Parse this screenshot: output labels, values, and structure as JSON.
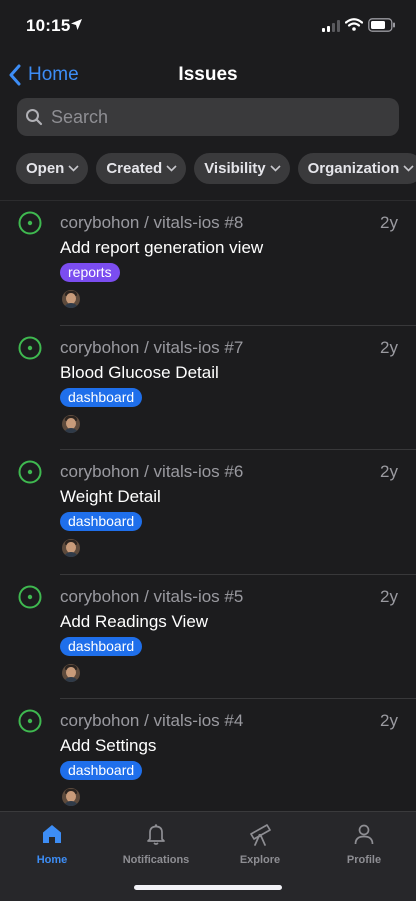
{
  "status": {
    "time": "10:15"
  },
  "nav": {
    "back_label": "Home",
    "title": "Issues"
  },
  "search": {
    "placeholder": "Search"
  },
  "filters": [
    {
      "label": "Open"
    },
    {
      "label": "Created"
    },
    {
      "label": "Visibility"
    },
    {
      "label": "Organization"
    }
  ],
  "issues": [
    {
      "repo": "corybohon / vitals-ios #8",
      "age": "2y",
      "title": "Add report generation view",
      "label": "reports",
      "label_color": "#7b4df0"
    },
    {
      "repo": "corybohon / vitals-ios #7",
      "age": "2y",
      "title": "Blood Glucose Detail",
      "label": "dashboard",
      "label_color": "#1f6feb"
    },
    {
      "repo": "corybohon / vitals-ios #6",
      "age": "2y",
      "title": "Weight Detail",
      "label": "dashboard",
      "label_color": "#1f6feb"
    },
    {
      "repo": "corybohon / vitals-ios #5",
      "age": "2y",
      "title": "Add Readings View",
      "label": "dashboard",
      "label_color": "#1f6feb"
    },
    {
      "repo": "corybohon / vitals-ios #4",
      "age": "2y",
      "title": "Add Settings",
      "label": "dashboard",
      "label_color": "#1f6feb"
    }
  ],
  "tabs": [
    {
      "label": "Home",
      "icon": "home-icon",
      "active": true
    },
    {
      "label": "Notifications",
      "icon": "bell-icon",
      "active": false
    },
    {
      "label": "Explore",
      "icon": "telescope-icon",
      "active": false
    },
    {
      "label": "Profile",
      "icon": "person-icon",
      "active": false
    }
  ],
  "colors": {
    "accent": "#3d8df5",
    "open_state": "#3fb950",
    "background": "#1c1c1e"
  }
}
